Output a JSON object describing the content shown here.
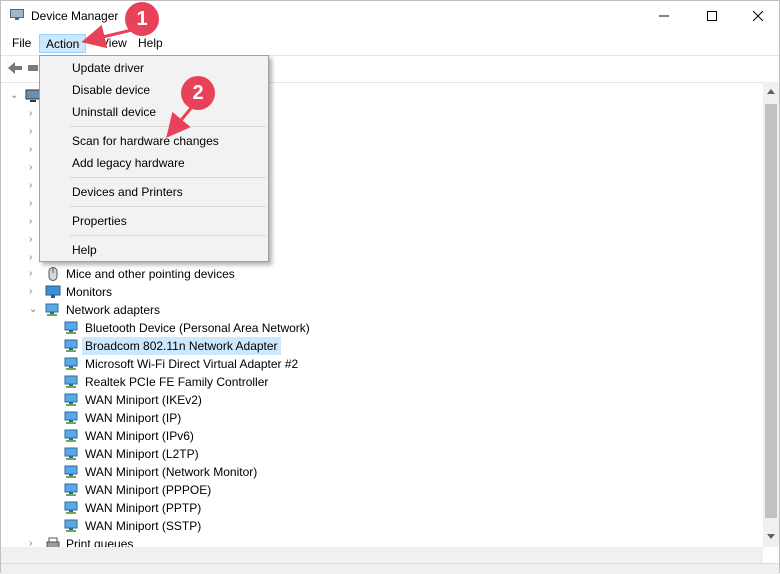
{
  "window": {
    "title": "Device Manager"
  },
  "menubar": {
    "items": [
      "File",
      "Action",
      "View",
      "Help"
    ]
  },
  "action_menu": {
    "groups": [
      [
        "Update driver",
        "Disable device",
        "Uninstall device"
      ],
      [
        "Scan for hardware changes",
        "Add legacy hardware"
      ],
      [
        "Devices and Printers"
      ],
      [
        "Properties"
      ],
      [
        "Help"
      ]
    ]
  },
  "tree": {
    "categories": [
      {
        "label": "Mice and other pointing devices",
        "icon": "mouse-icon"
      },
      {
        "label": "Monitors",
        "icon": "monitor-icon"
      },
      {
        "label": "Network adapters",
        "icon": "network-icon",
        "expanded": true
      }
    ],
    "network_adapters": [
      "Bluetooth Device (Personal Area Network)",
      "Broadcom 802.11n Network Adapter",
      "Microsoft Wi-Fi Direct Virtual Adapter #2",
      "Realtek PCIe FE Family Controller",
      "WAN Miniport (IKEv2)",
      "WAN Miniport (IP)",
      "WAN Miniport (IPv6)",
      "WAN Miniport (L2TP)",
      "WAN Miniport (Network Monitor)",
      "WAN Miniport (PPPOE)",
      "WAN Miniport (PPTP)",
      "WAN Miniport (SSTP)"
    ],
    "selected_adapter": "Broadcom 802.11n Network Adapter",
    "trailing_category": {
      "label": "Print queues",
      "icon": "printer-icon"
    }
  },
  "annotations": {
    "badge_1": "1",
    "badge_2": "2"
  },
  "colors": {
    "accent": "#e8425a",
    "selection": "#cce8ff"
  }
}
